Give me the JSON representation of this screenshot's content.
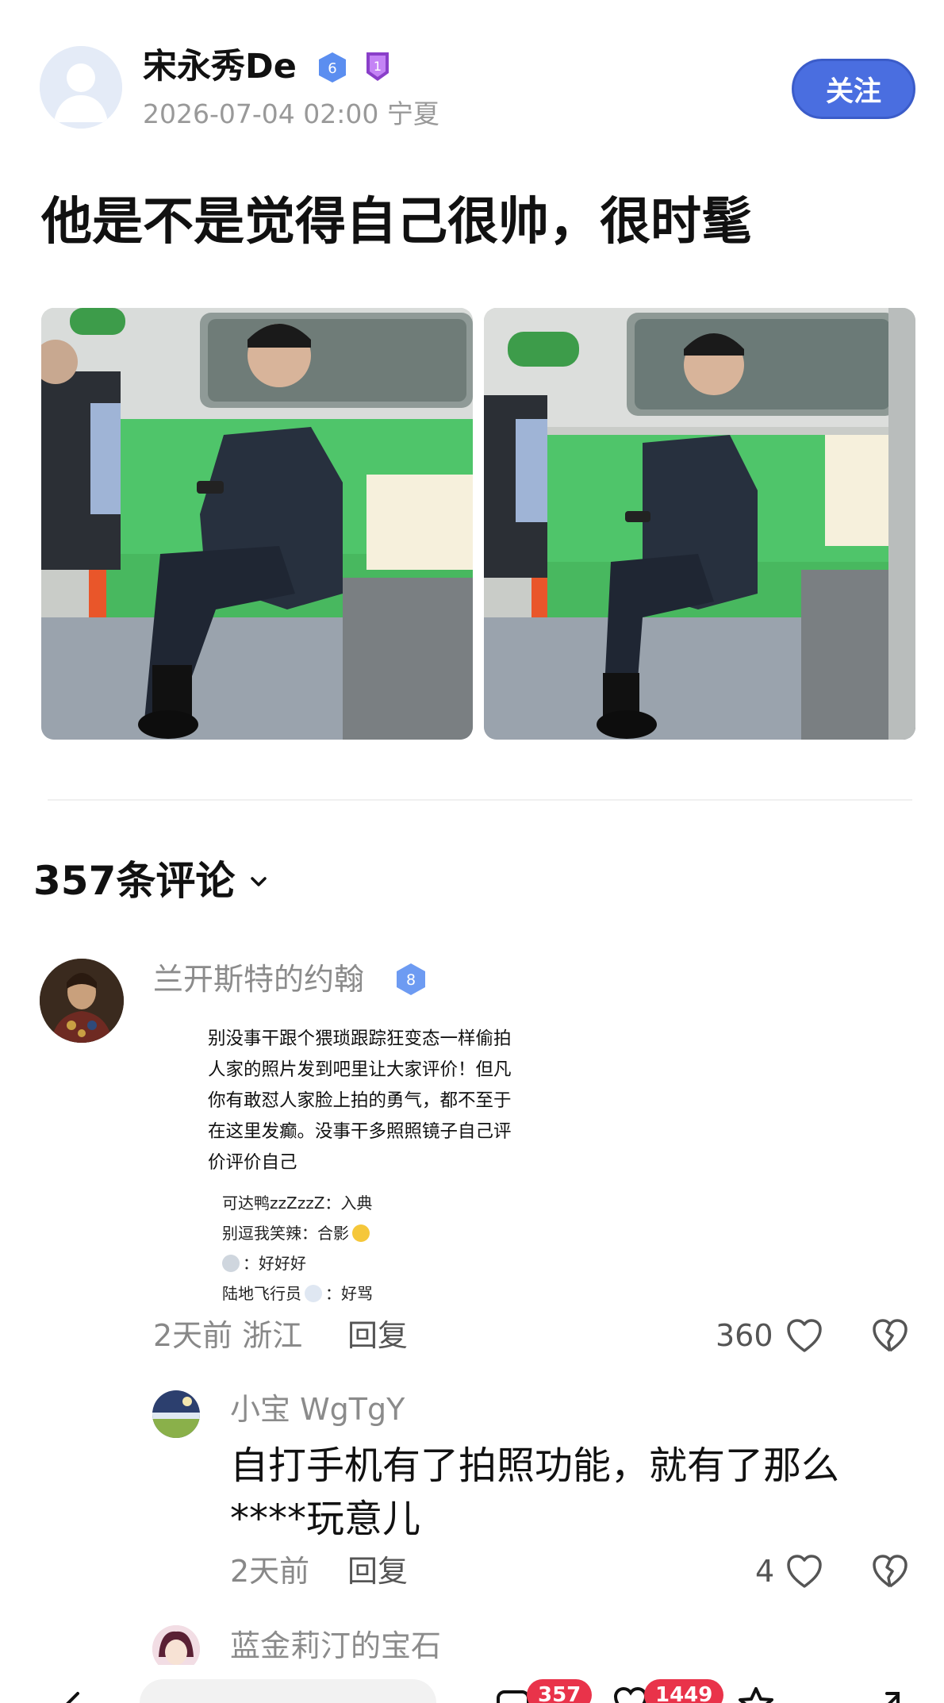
{
  "post": {
    "author": "宋永秀De",
    "level": "6",
    "medal": "1",
    "date_location": "2026-07-04 02:00 宁夏",
    "follow_label": "关注",
    "title": "他是不是觉得自己很帅，很时髦"
  },
  "comments_header": "357条评论",
  "comments": [
    {
      "name": "兰开斯特的约翰",
      "level": "8",
      "screenshot": {
        "text": "别没事干跟个猥琐跟踪狂变态一样偷拍人家的照片发到吧里让大家评价！但凡你有敢怼人家脸上拍的勇气，都不至于在这里发癫。没事干多照照镜子自己评价评价自己",
        "replies": [
          {
            "who": "可达鸭zzZzzZ",
            "sep": "：",
            "text": "入典"
          },
          {
            "who": "别逗我笑辣",
            "sep": "：",
            "text": "合影"
          },
          {
            "who": "",
            "sep": "：",
            "text": "好好好"
          },
          {
            "who": "陆地飞行员",
            "sep": "：",
            "text": "好骂"
          }
        ]
      },
      "time": "2天前 浙江",
      "reply_label": "回复",
      "likes": "360"
    },
    {
      "name": "小宝 WgTgY",
      "text": "自打手机有了拍照功能，就有了那么****玩意儿",
      "time": "2天前",
      "reply_label": "回复",
      "likes": "4"
    },
    {
      "name": "蓝金莉汀的宝石"
    }
  ],
  "bottom_bar": {
    "comments_badge": "357",
    "likes_badge": "1449"
  },
  "colors": {
    "accent": "#4a6ee0",
    "badge_red": "#e9334a",
    "seat_green": "#4fc56a"
  }
}
